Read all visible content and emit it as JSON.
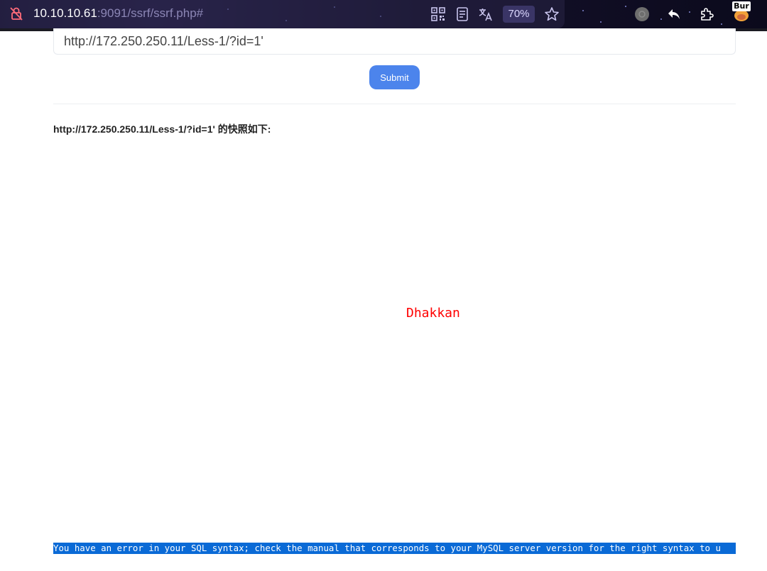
{
  "browser": {
    "url_host": "10.10.10.61",
    "url_path": ":9091/ssrf/ssrf.php#",
    "zoom_level": "70%",
    "extension_badge": "Bur",
    "icons": [
      "lock-slash-icon",
      "qr-code-icon",
      "reader-mode-icon",
      "translate-icon",
      "bookmark-star-icon",
      "extension-avatar-icon",
      "back-arrow-icon",
      "extensions-puzzle-icon",
      "burp-extension-icon"
    ]
  },
  "form": {
    "url_value": "http://172.250.250.11/Less-1/?id=1'",
    "submit_label": "Submit",
    "accent_color": "#4c84ec"
  },
  "result": {
    "snapshot_heading": "http://172.250.250.11/Less-1/?id=1' 的快照如下:",
    "page_title_text": "Dhakkan",
    "page_title_color": "#ff0000",
    "sql_error": "You have an error in your SQL syntax; check the manual that corresponds to your MySQL server version for the right syntax to u",
    "error_highlight_color": "#0a6ad6"
  }
}
